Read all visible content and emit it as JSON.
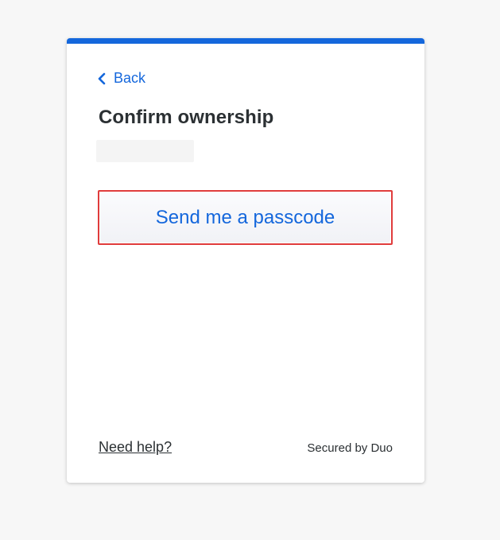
{
  "card": {
    "accent_color": "#1467dc"
  },
  "nav": {
    "back_label": "Back",
    "back_icon": "chevron-left-icon"
  },
  "header": {
    "title": "Confirm ownership"
  },
  "actions": {
    "send_passcode_label": "Send me a passcode"
  },
  "footer": {
    "help_label": "Need help?",
    "secured_label": "Secured by Duo"
  }
}
